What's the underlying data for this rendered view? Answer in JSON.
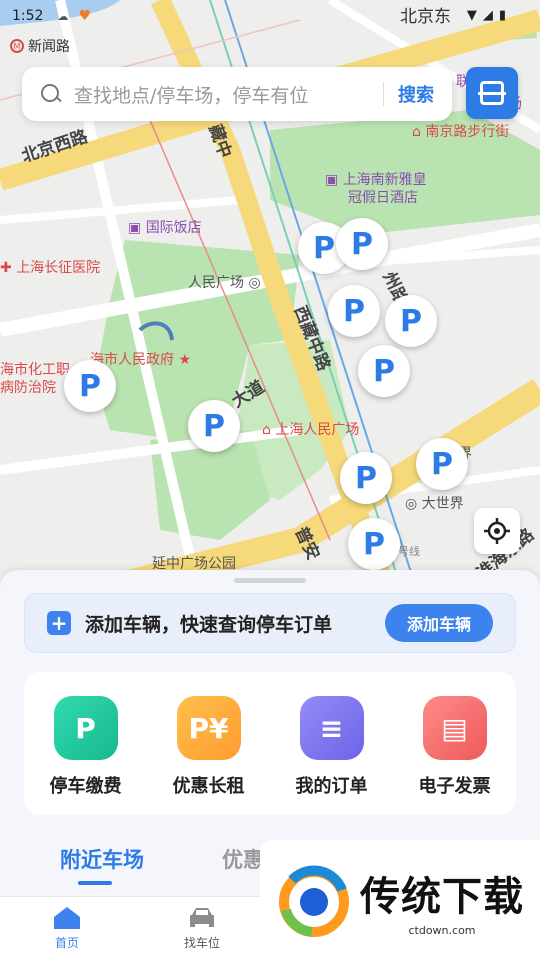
{
  "status_bar": {
    "time": "1:52",
    "map_text": "北京东"
  },
  "map": {
    "metro": {
      "icon": "metro-icon",
      "label": "新闻路"
    },
    "roads": [
      "北京西路",
      "西藏中路",
      "西藏中路",
      "大道",
      "州路",
      "普安",
      "淮海东路",
      "藏中"
    ],
    "pois": {
      "nanjing_road": "南京路步行街",
      "hotel_line1": "上海南新雅皇",
      "hotel_line2": "冠假日酒店",
      "guoji": "国际饭店",
      "changzheng": "上海长征医院",
      "people_square": "人民广场",
      "gov": "海市人民政府",
      "chemical_line1": "海市化工职",
      "chemical_line2": "病防治院",
      "museum": "上海人民广场",
      "dashijie": "大世界",
      "jie": "界",
      "park": "延中广场公园",
      "line": "号线",
      "lian": "联",
      "qu": "趣场"
    },
    "parking_pin_label": "P"
  },
  "search": {
    "placeholder": "查找地点/停车场，停车有位",
    "button": "搜索"
  },
  "add_vehicle": {
    "text": "添加车辆，快速查询停车订单",
    "button": "添加车辆"
  },
  "services": [
    {
      "label": "停车缴费",
      "icon": "parking-pay-icon",
      "color": "#1fc9a0"
    },
    {
      "label": "优惠长租",
      "icon": "discount-rent-icon",
      "color": "#ffa53c"
    },
    {
      "label": "我的订单",
      "icon": "order-icon",
      "color": "#7b72ef"
    },
    {
      "label": "电子发票",
      "icon": "invoice-icon",
      "color": "#f06a6a"
    }
  ],
  "tabs": {
    "active": "附近车场",
    "inactive": "优惠"
  },
  "bottom_nav": [
    {
      "label": "首页",
      "icon": "home-icon",
      "active": true
    },
    {
      "label": "找车位",
      "icon": "car-icon",
      "active": false
    }
  ],
  "watermark": {
    "brand": "传统下载",
    "url": "ctdown.com"
  },
  "colors": {
    "accent": "#2d7be5",
    "green_area": "#b9e3b0",
    "road_yellow": "#f6d97a"
  }
}
